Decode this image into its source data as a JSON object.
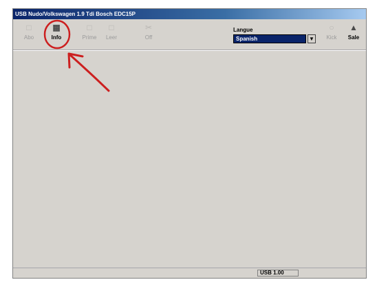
{
  "window": {
    "title": "USB Nudo/Volkswagen 1.9 Tdi Bosch EDC15P"
  },
  "toolbar": {
    "buttons": [
      {
        "label": "Abo",
        "icon": "open-icon",
        "active": false
      },
      {
        "label": "Info",
        "icon": "info-icon",
        "active": true
      },
      {
        "label": "Prime",
        "icon": "read-icon",
        "active": false
      },
      {
        "label": "Leer",
        "icon": "write-icon",
        "active": false
      },
      {
        "label": "Off",
        "icon": "cut-icon",
        "active": false
      }
    ],
    "right_buttons": [
      {
        "label": "Kick",
        "icon": "kick-icon",
        "active": false
      },
      {
        "label": "Sale",
        "icon": "exit-icon",
        "active": true
      }
    ]
  },
  "language": {
    "label": "Langue",
    "selected": "Spanish"
  },
  "status": {
    "text": "USB 1.00"
  },
  "annotation": {
    "color": "#cc1f1f"
  }
}
